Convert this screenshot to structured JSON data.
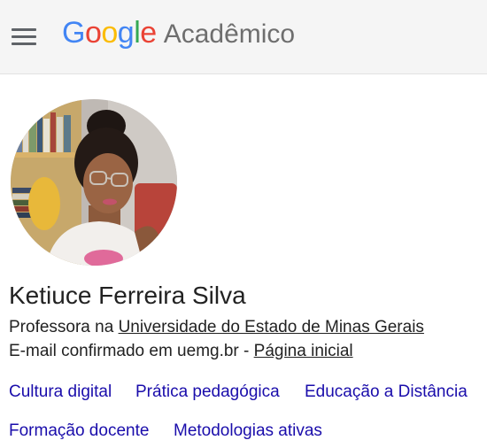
{
  "header": {
    "logo_letters": [
      {
        "char": "G",
        "color": "#4285F4"
      },
      {
        "char": "o",
        "color": "#EA4335"
      },
      {
        "char": "o",
        "color": "#FBBC05"
      },
      {
        "char": "g",
        "color": "#4285F4"
      },
      {
        "char": "l",
        "color": "#34A853"
      },
      {
        "char": "e",
        "color": "#EA4335"
      }
    ],
    "product": "Acadêmico",
    "menu_icon": "hamburger-menu-icon"
  },
  "profile": {
    "name": "Ketiuce Ferreira Silva",
    "affiliation_prefix": "Professora na ",
    "affiliation_link": "Universidade do Estado de Minas Gerais",
    "email_text": "E-mail confirmado em uemg.br - ",
    "homepage_link": "Página inicial",
    "interests": [
      "Cultura digital",
      "Prática pedagógica",
      "Educação a Distância",
      "Formação docente",
      "Metodologias ativas"
    ]
  },
  "colors": {
    "link": "#1a0dab",
    "text": "#222222",
    "header_bg": "#f5f5f5"
  }
}
